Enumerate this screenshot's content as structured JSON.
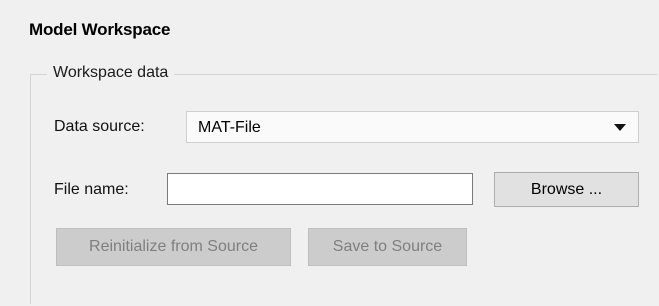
{
  "section": {
    "title": "Model Workspace"
  },
  "workspace_data": {
    "legend": "Workspace data",
    "data_source": {
      "label": "Data source:",
      "selected": "MAT-File"
    },
    "file_name": {
      "label": "File name:",
      "value": ""
    },
    "browse_label": "Browse ...",
    "reinitialize_label": "Reinitialize from Source",
    "save_label": "Save to Source"
  },
  "icons": {
    "dropdown": "chevron-down-icon"
  },
  "colors": {
    "background": "#f0f0f0",
    "disabled_button": "#cccccc",
    "disabled_text": "#7f7f7f",
    "enabled_button": "#e1e1e1"
  }
}
